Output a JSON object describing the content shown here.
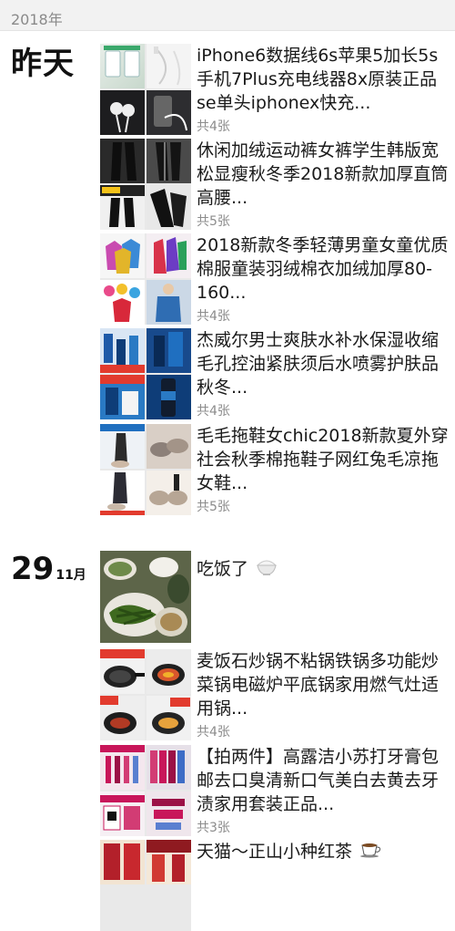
{
  "year_header": "2018年",
  "groups": [
    {
      "day": "昨天",
      "posts": [
        {
          "title": "iPhone6数据线6s苹果5加长5s手机7Plus充电线器8x原装正品se单头iphonex快充...",
          "count": "共4张",
          "thumb_colors": [
            "#dfe6e1",
            "#f0f0f0",
            "#1d1d1f",
            "#2a2a2c"
          ]
        },
        {
          "title": "休闲加绒运动裤女裤学生韩版宽松显瘦秋冬季2018新款加厚直筒高腰...",
          "count": "共5张",
          "thumb_colors": [
            "#1b1b1b",
            "#3a3a3a",
            "#2b2b2b",
            "#111111"
          ]
        },
        {
          "title": "2018新款冬季轻薄男童女童优质棉服童装羽绒棉衣加绒加厚80-160...",
          "count": "共4张",
          "thumb_colors": [
            "#c94bb0",
            "#d8324a",
            "#e94a8a",
            "#2f6db3"
          ]
        },
        {
          "title": "杰威尔男士爽肤水补水保湿收缩毛孔控油紧肤须后水喷雾护肤品秋冬...",
          "count": "共4张",
          "thumb_colors": [
            "#1e5aa8",
            "#184a8c",
            "#2a7ac4",
            "#0e3d78"
          ]
        },
        {
          "title": "毛毛拖鞋女chic2018新款夏外穿社会秋季棉拖鞋子网红兔毛凉拖女鞋...",
          "count": "共5张",
          "thumb_colors": [
            "#d9cfc6",
            "#8c8079",
            "#c9b8a8",
            "#b7a695"
          ]
        }
      ]
    },
    {
      "day_num": "29",
      "day_month": "11月",
      "posts": [
        {
          "title": "吃饭了",
          "count": "",
          "thumb_colors": [
            "#6e7d55",
            "#3c5a2a",
            "#c7c0ae",
            "#8a6a3b"
          ]
        },
        {
          "title": "麦饭石炒锅不粘锅铁锅多功能炒菜锅电磁炉平底锅家用燃气灶适用锅...",
          "count": "共4张",
          "thumb_colors": [
            "#222222",
            "#3a3a3a",
            "#b13a24",
            "#1f1f1f"
          ]
        },
        {
          "title": "【拍两件】高露洁小苏打牙膏包邮去口臭清新口气美白去黄去牙渍家用套装正品...",
          "count": "共3张",
          "thumb_colors": [
            "#c8165a",
            "#9b1246",
            "#d23c74",
            "#e6e0e8"
          ]
        },
        {
          "title": "天猫～正山小种红茶",
          "count": "",
          "thumb_colors": [
            "#b3202a",
            "#c8282e",
            "#8f1a20",
            "#d13a33"
          ]
        }
      ]
    }
  ]
}
